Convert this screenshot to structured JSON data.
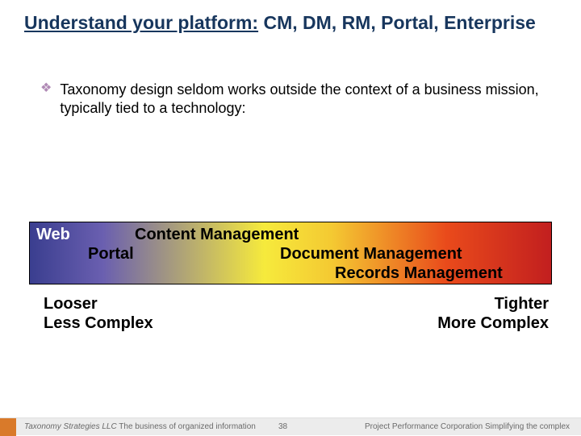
{
  "title": {
    "prefix": "Understand your platform:",
    "rest": " CM, DM, RM, Portal, Enterprise"
  },
  "bullet": {
    "icon": "❖",
    "text": "Taxonomy design seldom works outside the context of a business mission, typically tied to a technology:"
  },
  "band": {
    "web": "Web",
    "cm": "Content Management",
    "portal": "Portal",
    "dm": "Document Management",
    "rm": "Records Management"
  },
  "axis": {
    "left_line1": "Looser",
    "left_line2": "Less Complex",
    "right_line1": "Tighter",
    "right_line2": "More Complex"
  },
  "footer": {
    "brand": "Taxonomy Strategies LLC",
    "tagline": "  The business of organized information",
    "page": "38",
    "right": "Project Performance Corporation  Simplifying the complex"
  }
}
